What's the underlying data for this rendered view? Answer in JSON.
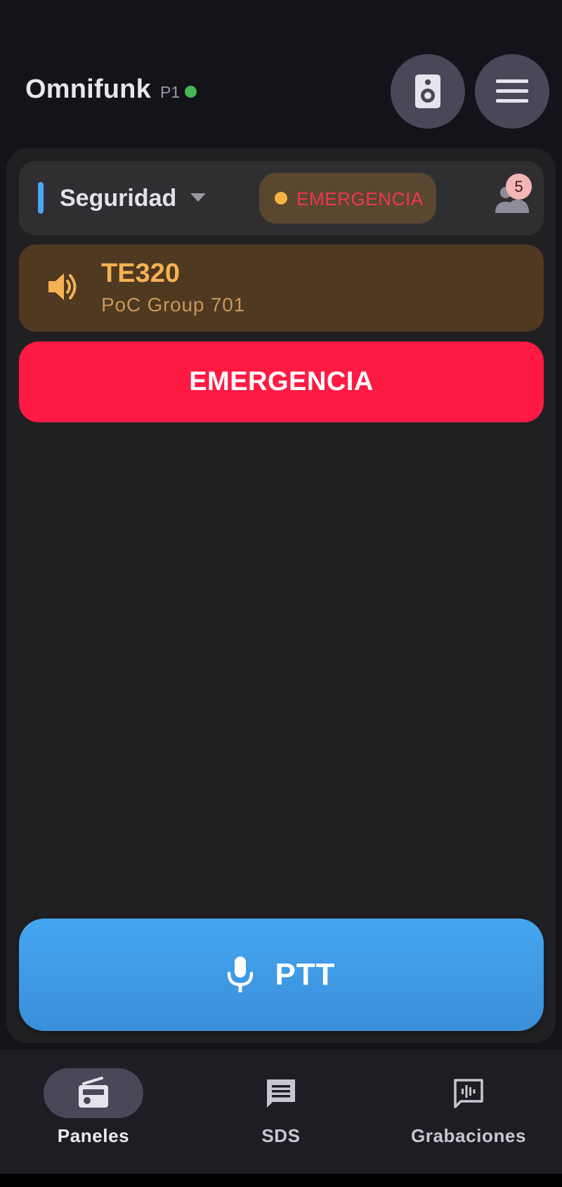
{
  "header": {
    "title": "Omnifunk",
    "profile": "P1",
    "status_color": "#46b954",
    "buttons": [
      {
        "icon": "speaker-icon"
      },
      {
        "icon": "menu-icon"
      }
    ]
  },
  "group_bar": {
    "group_name": "Seguridad",
    "accent_color": "#4aa8f2",
    "emergency_chip": "EMERGENCIA",
    "members_badge": "5"
  },
  "channel": {
    "name": "TE320",
    "subtitle": "PoC Group 701"
  },
  "emergency_button": "EMERGENCIA",
  "ptt_button": "PTT",
  "bottom_nav": {
    "items": [
      {
        "label": "Paneles",
        "icon": "radio-icon",
        "active": true
      },
      {
        "label": "SDS",
        "icon": "message-icon",
        "active": false
      },
      {
        "label": "Grabaciones",
        "icon": "voice-message-icon",
        "active": false
      }
    ]
  },
  "colors": {
    "emergency": "#ff1a44",
    "ptt": "#45a6f0",
    "channel_accent": "#f5b252"
  }
}
